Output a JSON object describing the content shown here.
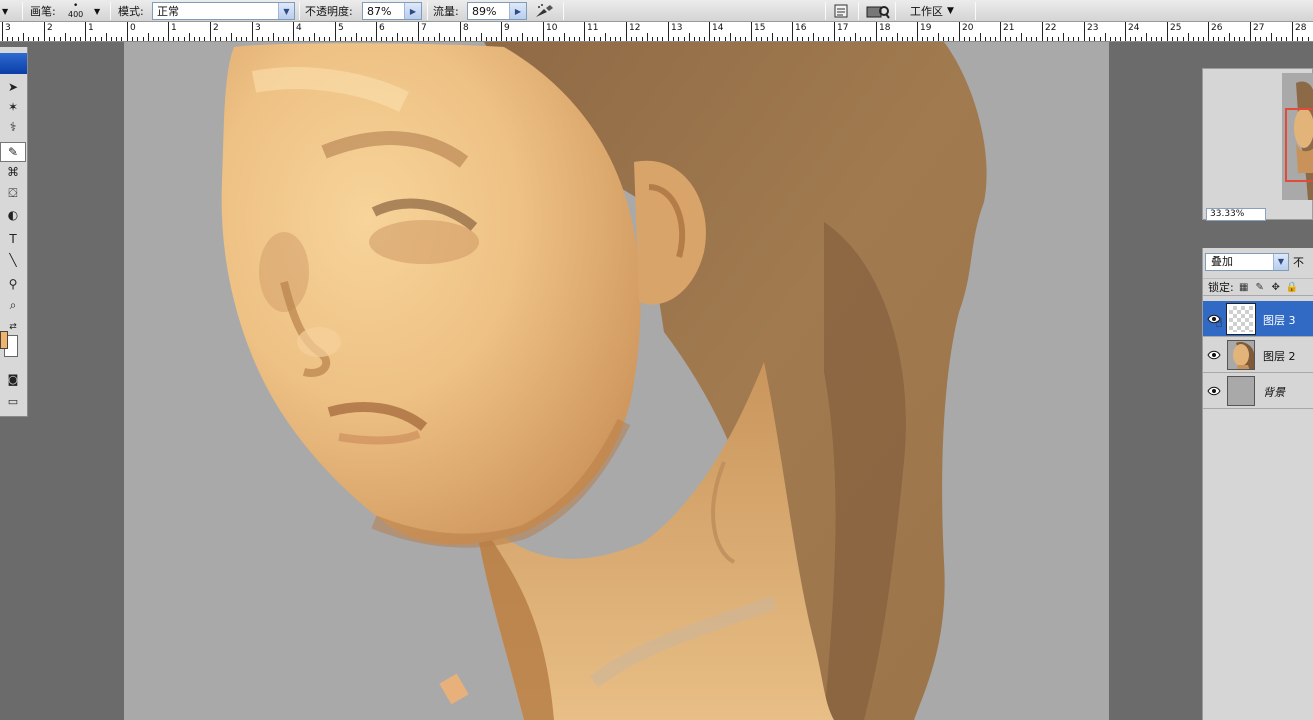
{
  "options_bar": {
    "brush_label": "画笔:",
    "brush_size": "400",
    "mode_label": "模式:",
    "mode_value": "正常",
    "opacity_label": "不透明度:",
    "opacity_value": "87%",
    "flow_label": "流量:",
    "flow_value": "89%",
    "workspace_label": "工作区"
  },
  "ruler": {
    "labels": [
      "3",
      "2",
      "1",
      "0",
      "1",
      "2",
      "3",
      "4",
      "5",
      "6",
      "7",
      "8",
      "9",
      "10",
      "11",
      "12",
      "13",
      "14",
      "15",
      "16",
      "17",
      "18",
      "19",
      "20",
      "21",
      "22",
      "23",
      "24",
      "25",
      "26",
      "27",
      "28"
    ]
  },
  "navigator": {
    "zoom": "33.33%"
  },
  "layers_panel": {
    "blend_mode": "叠加",
    "opacity_label": "不",
    "lock_label": "锁定:",
    "layers": [
      {
        "name": "图层 3",
        "selected": true,
        "thumb": "transparent"
      },
      {
        "name": "图层 2",
        "selected": false,
        "thumb": "portrait"
      },
      {
        "name": "背景",
        "selected": false,
        "thumb": "gray"
      }
    ]
  },
  "icons": {
    "airbrush": "airbrush-icon",
    "doc": "document-icon",
    "bridge": "bridge-icon",
    "eye": "eye-icon"
  }
}
